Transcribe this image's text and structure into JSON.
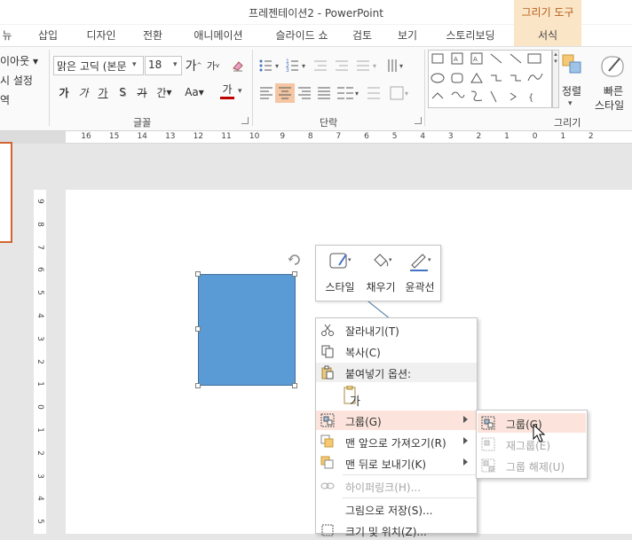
{
  "window": {
    "title": "프레젠테이션2 - PowerPoint",
    "context_tab_header": "그리기 도구"
  },
  "tabs": [
    "뉴",
    "삽입",
    "디자인",
    "전환",
    "애니메이션",
    "슬라이드 쇼",
    "검토",
    "보기",
    "스토리보딩",
    "서식"
  ],
  "ribbon": {
    "slides_group": {
      "layout": "이아웃",
      "reset": "시 설정",
      "section": "역"
    },
    "font_group": {
      "label": "글꼴",
      "font_name": "맑은 고딕 (본문",
      "font_size": "18",
      "grow": "가",
      "shrink": "가",
      "bold": "가",
      "italic": "가",
      "underline": "가",
      "strike": "가",
      "spacing": "간",
      "case": "Aa",
      "color": "가",
      "font_color": "#c00000"
    },
    "paragraph_group": {
      "label": "단락"
    },
    "drawing_group": {
      "label": "그리기",
      "arrange": "정렬",
      "quick_styles_1": "빠른",
      "quick_styles_2": "스타일"
    }
  },
  "ruler": {
    "h_ticks": [
      "16",
      "15",
      "14",
      "13",
      "12",
      "11",
      "10",
      "9",
      "8",
      "7",
      "6",
      "5",
      "4",
      "3",
      "2",
      "1",
      "0",
      "1",
      "2"
    ],
    "v_ticks": [
      "9",
      "8",
      "7",
      "6",
      "5",
      "4",
      "3",
      "2",
      "1",
      "0",
      "1",
      "2",
      "3",
      "4",
      "5"
    ]
  },
  "minibar": {
    "style": "스타일",
    "fill": "채우기",
    "outline": "윤곽선"
  },
  "context_menu": {
    "items": [
      {
        "label": "잘라내기(T)",
        "icon": "scissors-icon"
      },
      {
        "label": "복사(C)",
        "icon": "copy-icon"
      },
      {
        "label": "붙여넣기 옵션:",
        "icon": "paste-icon"
      },
      {
        "label": "그룹(G)",
        "icon": "group-icon"
      },
      {
        "label": "맨 앞으로 가져오기(R)",
        "icon": "bring-front-icon"
      },
      {
        "label": "맨 뒤로 보내기(K)",
        "icon": "send-back-icon"
      },
      {
        "label": "하이퍼링크(H)...",
        "icon": "hyperlink-icon"
      },
      {
        "label": "그림으로 저장(S)...",
        "icon": "none"
      },
      {
        "label": "크기 및 위치(Z)...",
        "icon": "size-icon"
      }
    ],
    "paste_option": "가"
  },
  "submenu": {
    "items": [
      {
        "label": "그룹(G)",
        "enabled": true
      },
      {
        "label": "재그룹(E)",
        "enabled": false
      },
      {
        "label": "그룹 해제(U)",
        "enabled": false
      }
    ]
  },
  "colors": {
    "accent": "#d26433",
    "shape_fill": "#5b9bd5",
    "highlight": "#fce4dc",
    "context_tab": "#fbe5c7"
  }
}
